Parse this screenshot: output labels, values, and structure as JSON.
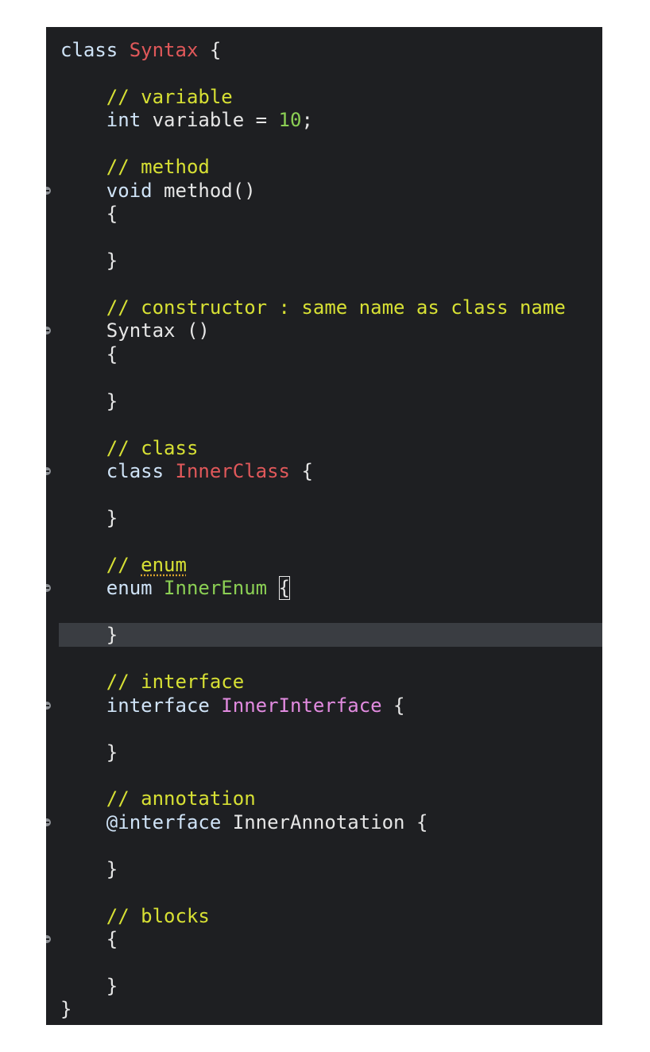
{
  "editor": {
    "lines": [
      {
        "fold": false,
        "current": false,
        "indent": "",
        "tokens": [
          {
            "t": "class ",
            "c": "kw"
          },
          {
            "t": "Syntax",
            "c": "cls"
          },
          {
            "t": " {",
            "c": "pl"
          }
        ]
      },
      {
        "fold": false,
        "current": false,
        "indent": "",
        "tokens": []
      },
      {
        "fold": false,
        "current": false,
        "indent": "    ",
        "tokens": [
          {
            "t": "// variable",
            "c": "cm"
          }
        ]
      },
      {
        "fold": false,
        "current": false,
        "indent": "    ",
        "tokens": [
          {
            "t": "int ",
            "c": "kw"
          },
          {
            "t": "variable = ",
            "c": "pl"
          },
          {
            "t": "10",
            "c": "num"
          },
          {
            "t": ";",
            "c": "pl"
          }
        ]
      },
      {
        "fold": false,
        "current": false,
        "indent": "",
        "tokens": []
      },
      {
        "fold": false,
        "current": false,
        "indent": "    ",
        "tokens": [
          {
            "t": "// method",
            "c": "cm"
          }
        ]
      },
      {
        "fold": true,
        "current": false,
        "indent": "    ",
        "tokens": [
          {
            "t": "void ",
            "c": "kw"
          },
          {
            "t": "method()",
            "c": "pl"
          }
        ]
      },
      {
        "fold": false,
        "current": false,
        "indent": "    ",
        "tokens": [
          {
            "t": "{",
            "c": "pl"
          }
        ]
      },
      {
        "fold": false,
        "current": false,
        "indent": "",
        "tokens": []
      },
      {
        "fold": false,
        "current": false,
        "indent": "    ",
        "tokens": [
          {
            "t": "}",
            "c": "pl"
          }
        ]
      },
      {
        "fold": false,
        "current": false,
        "indent": "",
        "tokens": []
      },
      {
        "fold": false,
        "current": false,
        "indent": "    ",
        "tokens": [
          {
            "t": "// constructor : same name as class name",
            "c": "cm"
          }
        ]
      },
      {
        "fold": true,
        "current": false,
        "indent": "    ",
        "tokens": [
          {
            "t": "Syntax ()",
            "c": "pl"
          }
        ]
      },
      {
        "fold": false,
        "current": false,
        "indent": "    ",
        "tokens": [
          {
            "t": "{",
            "c": "pl"
          }
        ]
      },
      {
        "fold": false,
        "current": false,
        "indent": "",
        "tokens": []
      },
      {
        "fold": false,
        "current": false,
        "indent": "    ",
        "tokens": [
          {
            "t": "}",
            "c": "pl"
          }
        ]
      },
      {
        "fold": false,
        "current": false,
        "indent": "",
        "tokens": []
      },
      {
        "fold": false,
        "current": false,
        "indent": "    ",
        "tokens": [
          {
            "t": "// class",
            "c": "cm"
          }
        ]
      },
      {
        "fold": true,
        "current": false,
        "indent": "    ",
        "tokens": [
          {
            "t": "class ",
            "c": "kw"
          },
          {
            "t": "InnerClass",
            "c": "cls"
          },
          {
            "t": " {",
            "c": "pl"
          }
        ]
      },
      {
        "fold": false,
        "current": false,
        "indent": "",
        "tokens": []
      },
      {
        "fold": false,
        "current": false,
        "indent": "    ",
        "tokens": [
          {
            "t": "}",
            "c": "pl"
          }
        ]
      },
      {
        "fold": false,
        "current": false,
        "indent": "",
        "tokens": []
      },
      {
        "fold": false,
        "current": false,
        "indent": "    ",
        "tokens": [
          {
            "t": "// ",
            "c": "cm"
          },
          {
            "t": "enum",
            "c": "cm spell"
          }
        ]
      },
      {
        "fold": true,
        "current": false,
        "indent": "    ",
        "tokens": [
          {
            "t": "enum ",
            "c": "kw"
          },
          {
            "t": "InnerEnum",
            "c": "enumname"
          },
          {
            "t": " ",
            "c": "pl"
          },
          {
            "t": "{",
            "c": "pl cursor"
          }
        ]
      },
      {
        "fold": false,
        "current": false,
        "indent": "",
        "tokens": []
      },
      {
        "fold": false,
        "current": true,
        "indent": "    ",
        "tokens": [
          {
            "t": "}",
            "c": "pl"
          }
        ]
      },
      {
        "fold": false,
        "current": false,
        "indent": "",
        "tokens": []
      },
      {
        "fold": false,
        "current": false,
        "indent": "    ",
        "tokens": [
          {
            "t": "// interface",
            "c": "cm"
          }
        ]
      },
      {
        "fold": true,
        "current": false,
        "indent": "    ",
        "tokens": [
          {
            "t": "interface ",
            "c": "kw"
          },
          {
            "t": "InnerInterface",
            "c": "iface"
          },
          {
            "t": " {",
            "c": "pl"
          }
        ]
      },
      {
        "fold": false,
        "current": false,
        "indent": "",
        "tokens": []
      },
      {
        "fold": false,
        "current": false,
        "indent": "    ",
        "tokens": [
          {
            "t": "}",
            "c": "pl"
          }
        ]
      },
      {
        "fold": false,
        "current": false,
        "indent": "",
        "tokens": []
      },
      {
        "fold": false,
        "current": false,
        "indent": "    ",
        "tokens": [
          {
            "t": "// annotation",
            "c": "cm"
          }
        ]
      },
      {
        "fold": true,
        "current": false,
        "indent": "    ",
        "tokens": [
          {
            "t": "@interface ",
            "c": "kw"
          },
          {
            "t": "InnerAnnotation {",
            "c": "pl"
          }
        ]
      },
      {
        "fold": false,
        "current": false,
        "indent": "",
        "tokens": []
      },
      {
        "fold": false,
        "current": false,
        "indent": "    ",
        "tokens": [
          {
            "t": "}",
            "c": "pl"
          }
        ]
      },
      {
        "fold": false,
        "current": false,
        "indent": "",
        "tokens": []
      },
      {
        "fold": false,
        "current": false,
        "indent": "    ",
        "tokens": [
          {
            "t": "// blocks",
            "c": "cm"
          }
        ]
      },
      {
        "fold": true,
        "current": false,
        "indent": "    ",
        "tokens": [
          {
            "t": "{",
            "c": "pl"
          }
        ]
      },
      {
        "fold": false,
        "current": false,
        "indent": "",
        "tokens": []
      },
      {
        "fold": false,
        "current": false,
        "indent": "    ",
        "tokens": [
          {
            "t": "}",
            "c": "pl"
          }
        ]
      },
      {
        "fold": false,
        "current": false,
        "indent": "",
        "tokens": [
          {
            "t": "}",
            "c": "pl"
          }
        ]
      }
    ]
  }
}
